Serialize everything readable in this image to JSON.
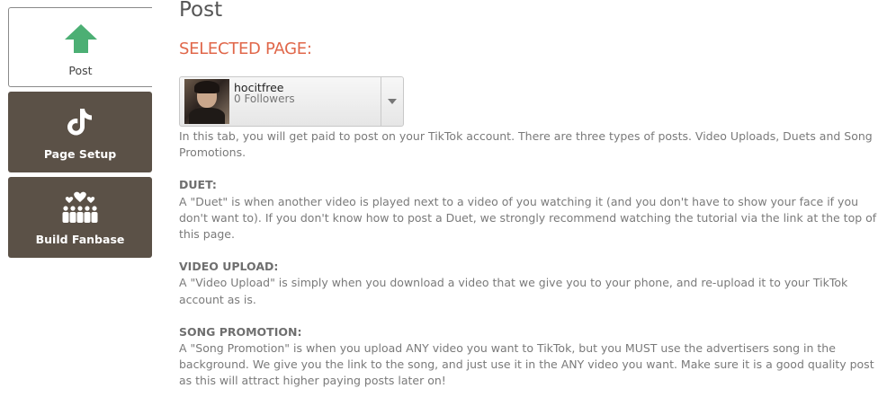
{
  "sidebar": {
    "tabs": [
      {
        "label": "Post",
        "icon": "arrow-up-icon",
        "active": true
      },
      {
        "label": "Page Setup",
        "icon": "tiktok-icon",
        "active": false
      },
      {
        "label": "Build Fanbase",
        "icon": "fanbase-icon",
        "active": false
      }
    ]
  },
  "main": {
    "title": "Post",
    "selected_heading": "SELECTED PAGE:",
    "selector": {
      "name": "hocitfree",
      "followers": "0 Followers"
    },
    "intro": "In this tab, you will get paid to post on your TikTok account. There are three types of posts. Video Uploads, Duets and Song Promotions.",
    "sections": [
      {
        "label": "DUET:",
        "text": "A \"Duet\" is when another video is played next to a video of you watching it (and you don't have to show your face if you don't want to). If you don't know how to post a Duet, we strongly recommend watching the tutorial via the link at the top of this page."
      },
      {
        "label": "VIDEO UPLOAD:",
        "text": "A \"Video Upload\" is simply when you download a video that we give you to your phone, and re-upload it to your TikTok account as is."
      },
      {
        "label": "SONG PROMOTION:",
        "text": "A \"Song Promotion\" is when you upload ANY video you want to TikTok, but you MUST use the advertisers song in the background. We give you the link to the song, and just use it in the ANY video you want. Make sure it is a good quality post as this will attract higher paying posts later on!"
      }
    ]
  },
  "colors": {
    "accent_green": "#4caf74",
    "heading_orange": "#e0674a",
    "tab_dark": "#5b5147"
  }
}
